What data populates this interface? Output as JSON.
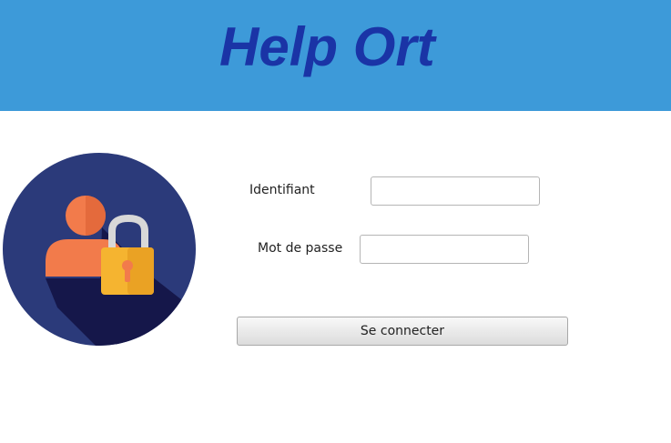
{
  "header": {
    "title": "Help Ort",
    "background_color": "#3d9ad9",
    "title_color": "#1a34a6"
  },
  "logo": {
    "icon": "user-lock-icon",
    "circle_color": "#2b3a7a",
    "user_color": "#f27b4b",
    "lock_color": "#f5b430"
  },
  "login_form": {
    "username_label": "Identifiant",
    "username_value": "",
    "password_label": "Mot de passe",
    "password_value": "",
    "submit_label": "Se connecter"
  }
}
